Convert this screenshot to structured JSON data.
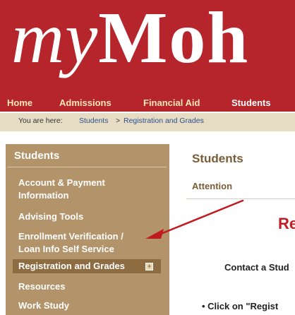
{
  "header": {
    "logo_part1": "my",
    "logo_part2": "Moh"
  },
  "nav": {
    "items": [
      {
        "label": "Home"
      },
      {
        "label": "Admissions"
      },
      {
        "label": "Financial Aid"
      },
      {
        "label": "Students"
      }
    ]
  },
  "breadcrumb": {
    "prefix": "You are here:",
    "link": "Students",
    "separator": ">",
    "current": "Registration and Grades"
  },
  "sidebar": {
    "title": "Students",
    "items": [
      {
        "line1": "Account & Payment",
        "line2": "Information"
      },
      {
        "line1": "Advising Tools"
      },
      {
        "line1": "Enrollment Verification /",
        "line2": "Loan Info Self Service"
      },
      {
        "line1": "Registration and Grades"
      },
      {
        "line1": "Resources"
      },
      {
        "line1": "Work Study"
      }
    ]
  },
  "main": {
    "title": "Students",
    "attention": "Attention",
    "heading": "Re",
    "contact": "Contact a Stud",
    "bullet": "•   Click on \"Regist"
  },
  "colors": {
    "header_red": "#b5252b",
    "sidebar_tan": "#b3946a",
    "arrow_red": "#c01a1f"
  }
}
